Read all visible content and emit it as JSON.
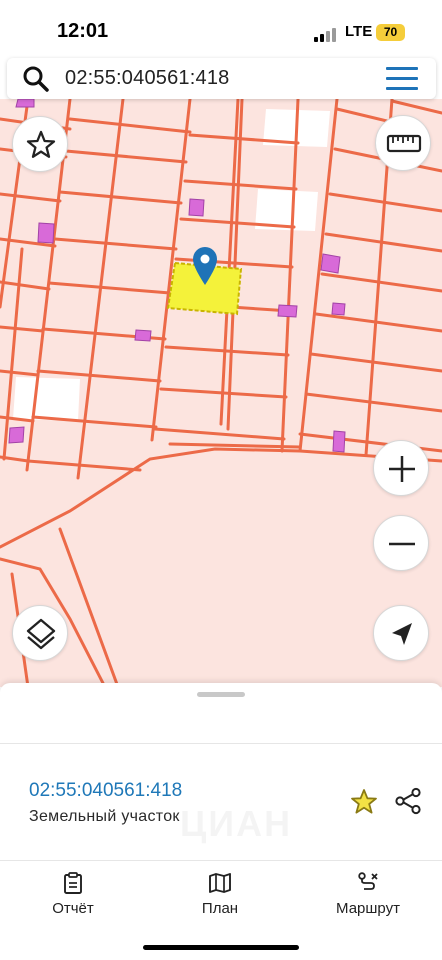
{
  "status_bar": {
    "time": "12:01",
    "network": "LTE",
    "battery": "70"
  },
  "search": {
    "query": "02:55:040561:418",
    "icon": "search-icon",
    "menu_icon": "hamburger-menu-icon"
  },
  "map": {
    "colors": {
      "background": "#fce4df",
      "parcel_border": "#ec6a48",
      "building": "#d86ad8",
      "selected_parcel": "#f4f23a",
      "selected_border": "#c9b400",
      "pin": "#1f73b7"
    },
    "controls": {
      "favorite": "star-outline-icon",
      "ruler": "ruler-icon",
      "zoom_in": "plus-icon",
      "zoom_out": "minus-icon",
      "layers": "layers-icon",
      "locate": "navigation-arrow-icon"
    }
  },
  "sheet": {
    "parcel_number": "02:55:040561:418",
    "parcel_type": "Земельный участок",
    "watermark": "ЦИАН",
    "tabs": [
      {
        "label": "Отчёт",
        "icon": "clipboard-icon"
      },
      {
        "label": "План",
        "icon": "map-icon"
      },
      {
        "label": "Маршрут",
        "icon": "route-icon"
      }
    ]
  }
}
